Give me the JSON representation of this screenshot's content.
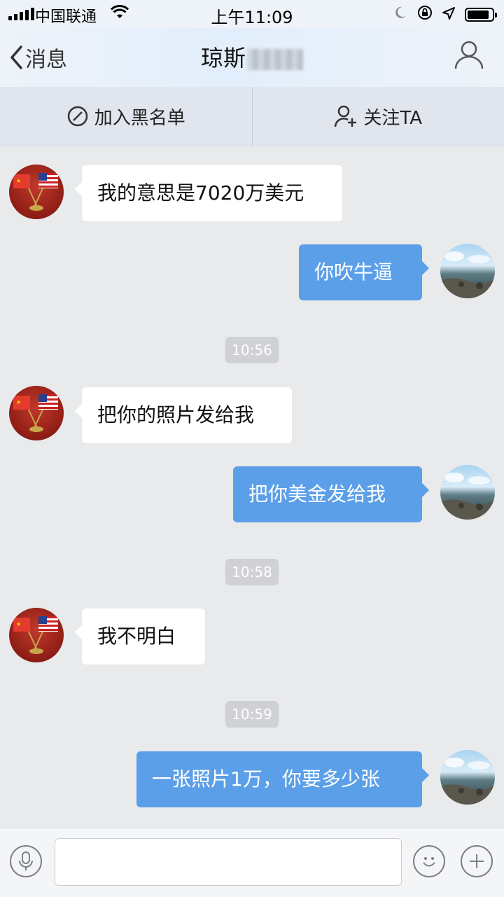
{
  "status_bar": {
    "carrier": "中国联通",
    "time": "上午11:09",
    "icons": [
      "signal-icon",
      "wifi-icon",
      "moon-icon",
      "rotation-lock-icon",
      "location-icon",
      "battery-icon"
    ]
  },
  "nav": {
    "back_label": "消息",
    "title": "琼斯",
    "title_obscured": true,
    "profile_icon": "person-icon"
  },
  "actions": {
    "blacklist_label": "加入黑名单",
    "follow_label": "关注TA"
  },
  "messages": [
    {
      "type": "incoming",
      "text": "我的意思是7020万美元",
      "avatar": "flags-avatar"
    },
    {
      "type": "outgoing",
      "text": "你吹牛逼",
      "avatar": "sea-avatar"
    },
    {
      "type": "timestamp",
      "text": "10:56"
    },
    {
      "type": "incoming",
      "text": "把你的照片发给我",
      "avatar": "flags-avatar"
    },
    {
      "type": "outgoing",
      "text": "把你美金发给我",
      "avatar": "sea-avatar"
    },
    {
      "type": "timestamp",
      "text": "10:58"
    },
    {
      "type": "incoming",
      "text": "我不明白",
      "avatar": "flags-avatar"
    },
    {
      "type": "timestamp",
      "text": "10:59"
    },
    {
      "type": "outgoing",
      "text": "一张照片1万，你要多少张",
      "avatar": "sea-avatar"
    }
  ],
  "input_bar": {
    "placeholder": "",
    "icons": [
      "microphone-icon",
      "emoji-icon",
      "plus-icon"
    ]
  },
  "colors": {
    "outgoing_bubble": "#5b9fe8",
    "incoming_bubble": "#ffffff",
    "background": "#e9eaec"
  }
}
